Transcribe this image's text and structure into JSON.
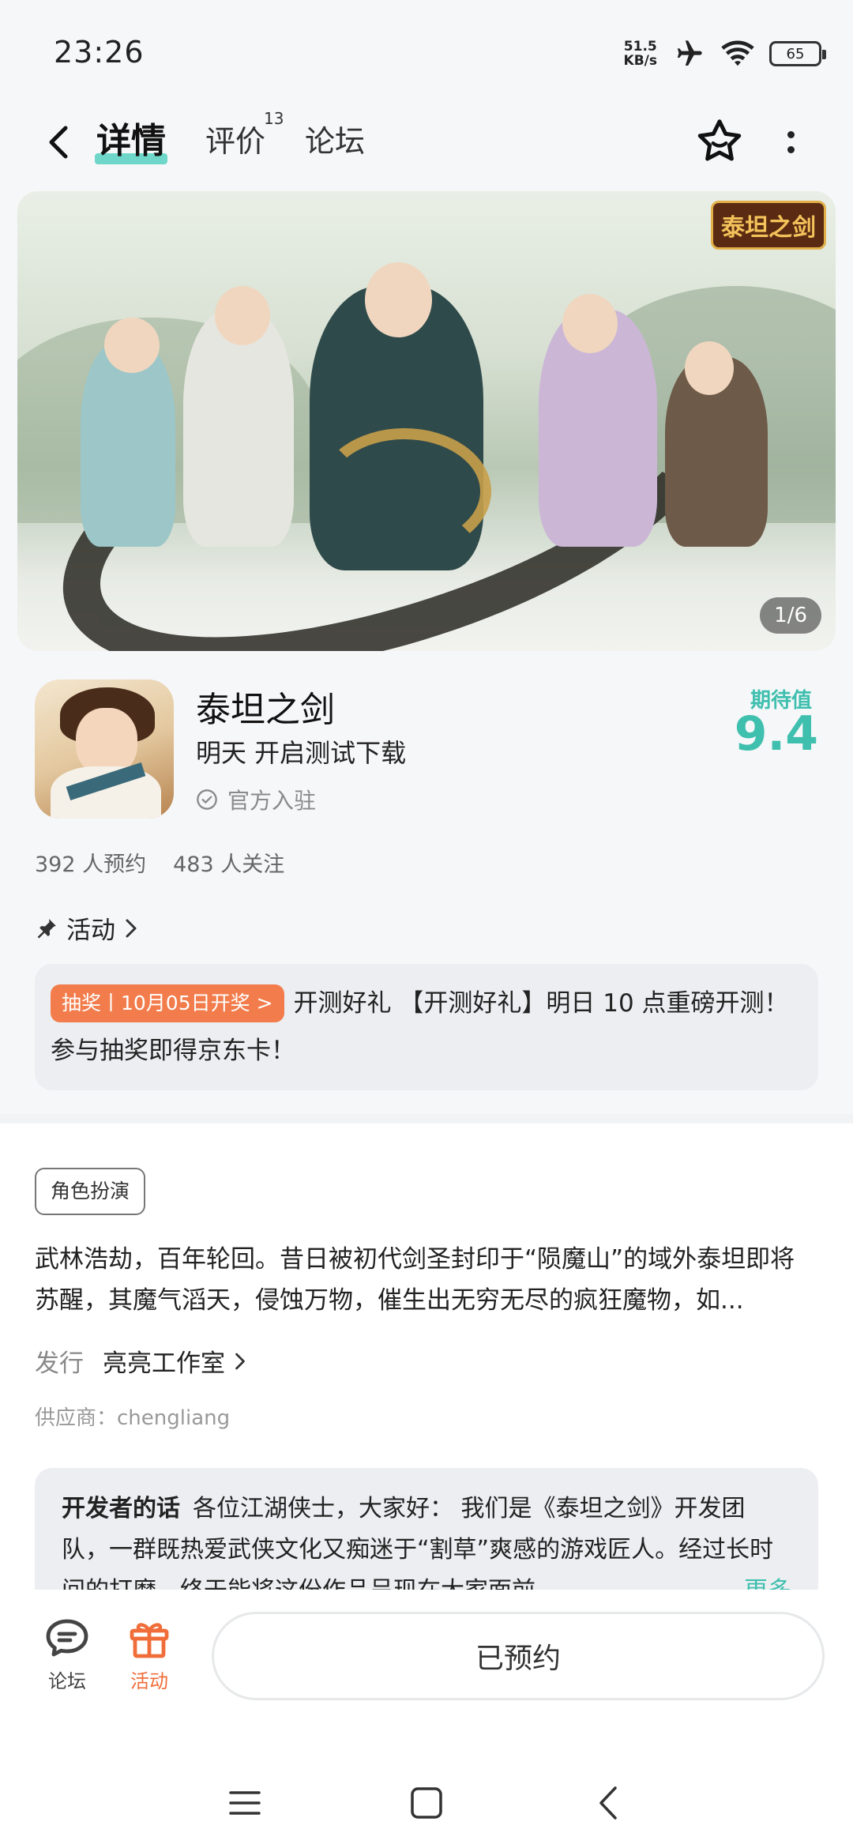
{
  "status_bar": {
    "time": "23:26",
    "net_speed_value": "51.5",
    "net_speed_unit": "KB/s",
    "battery": "65",
    "icons": [
      "airplane-icon",
      "wifi-icon",
      "battery-icon"
    ]
  },
  "nav": {
    "tabs": [
      {
        "label": "详情",
        "active": true
      },
      {
        "label": "评价",
        "badge": "13"
      },
      {
        "label": "论坛"
      }
    ],
    "icons": [
      "back-icon",
      "star-icon",
      "more-icon"
    ]
  },
  "banner": {
    "logo_text": "泰坦之剑",
    "counter": "1/6"
  },
  "app": {
    "name": "泰坦之剑",
    "status": "明天 开启测试下载",
    "official": "官方入驻",
    "score_label": "期待值",
    "score_value": "9.4",
    "reservations": "392 人预约",
    "followers": "483 人关注"
  },
  "activity": {
    "header": "活动",
    "badge": "抽奖丨10月05日开奖 >",
    "text": "开测好礼 【开测好礼】明日 10 点重磅开测！参与抽奖即得京东卡！"
  },
  "details": {
    "genre": "角色扮演",
    "description": "武林浩劫，百年轮回。昔日被初代剑圣封印于“陨魔山”的域外泰坦即将苏醒，其魔气滔天，侵蚀万物，催生出无穷无尽的疯狂魔物，如...",
    "publisher_label": "发行",
    "publisher": "亮亮工作室",
    "supplier": "供应商：chengliang"
  },
  "developer": {
    "title": "开发者的话",
    "text": "各位江湖侠士，大家好： 我们是《泰坦之剑》开发团队，一群既热爱武侠文化又痴迷于“割草”爽感的游戏匠人。经过长时间的打磨，终于能将这份作品呈现在大家面前。",
    "more": "更多"
  },
  "bottom_bar": {
    "forum_label": "论坛",
    "activity_label": "活动",
    "reserve_button": "已预约"
  },
  "colors": {
    "accent": "#3fbfae",
    "tab_underline": "#6fd7c9",
    "lottery": "#f27c4b",
    "activity_icon": "#f06d3a"
  }
}
